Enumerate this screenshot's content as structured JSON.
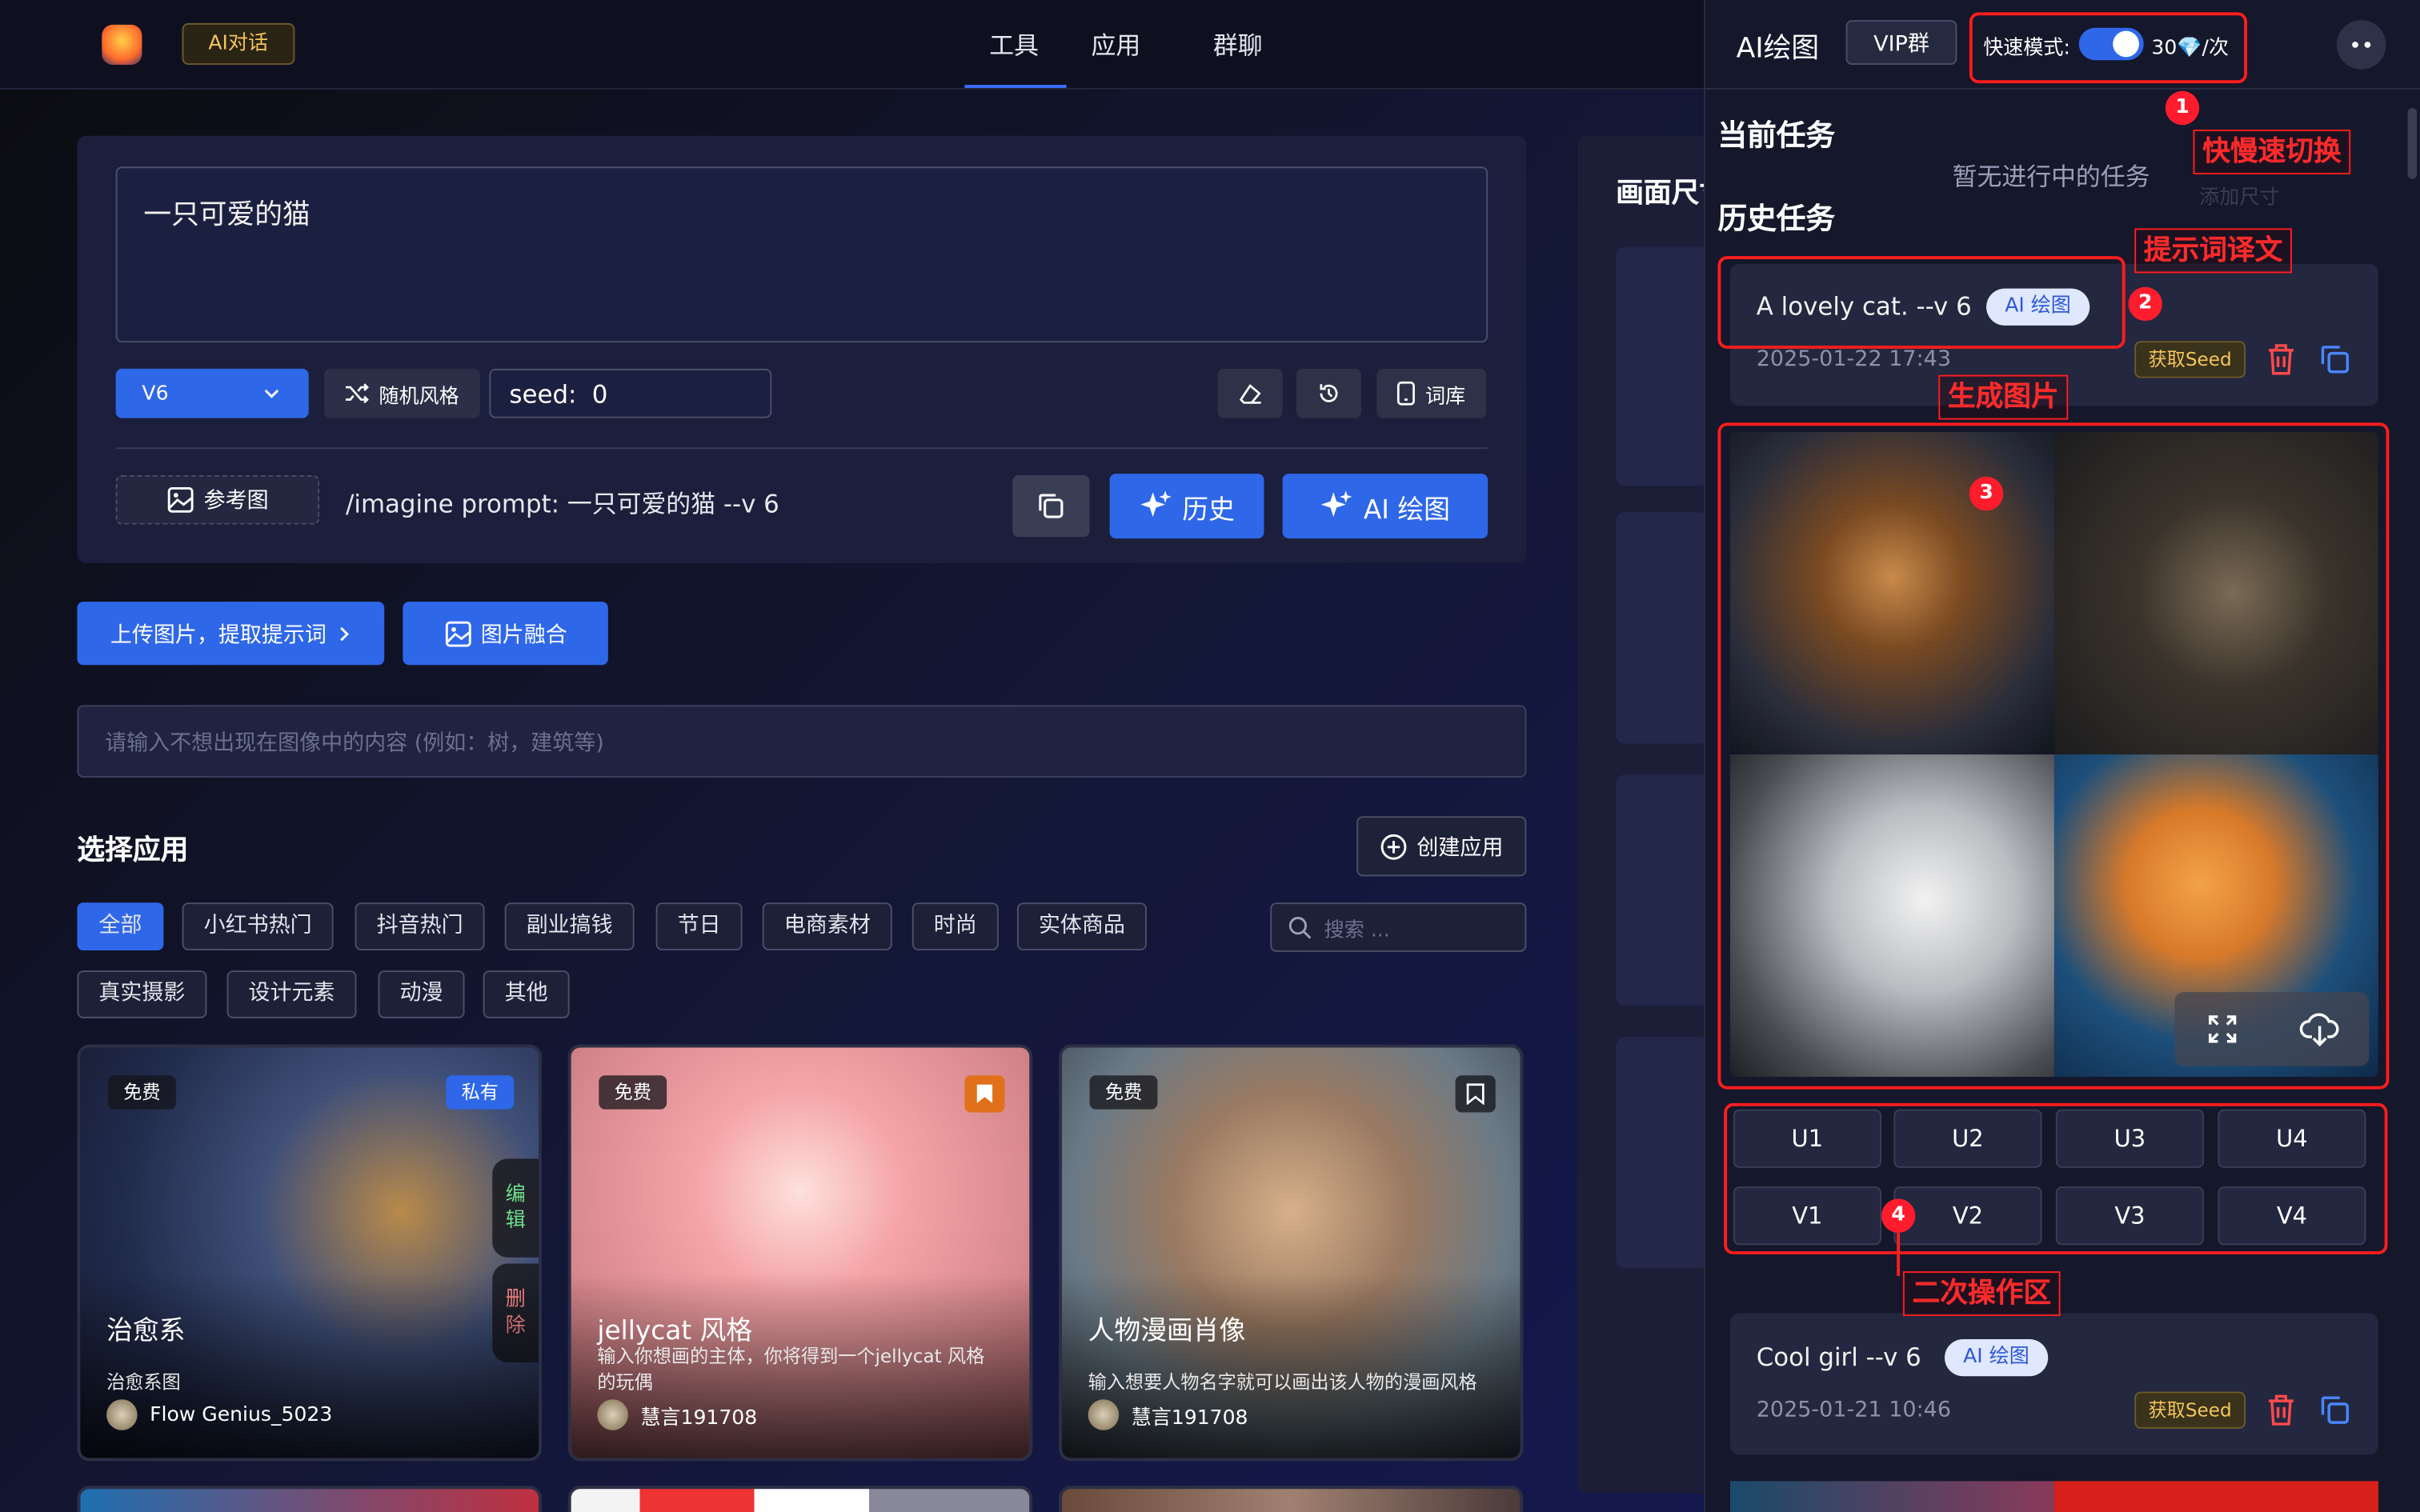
{
  "header": {
    "ai_chat": "AI对话",
    "tabs": [
      "工具",
      "应用",
      "群聊"
    ]
  },
  "prompt": {
    "text": "一只可爱的猫",
    "model": "V6",
    "random_style": "随机风格",
    "seed_label": "seed:",
    "seed_value": "0",
    "lexicon": "词库",
    "ref_image": "参考图",
    "imagine_cmd": "/imagine prompt: 一只可爱的猫 --v 6",
    "history": "历史",
    "ai_draw": "AI 绘图"
  },
  "actions": {
    "upload": "上传图片，提取提示词",
    "fusion": "图片融合",
    "negative_placeholder": "请输入不想出现在图像中的内容 (例如：树，建筑等)"
  },
  "apps": {
    "title": "选择应用",
    "create": "创建应用",
    "search_placeholder": "搜索 ...",
    "categories": [
      "全部",
      "小红书热门",
      "抖音热门",
      "副业搞钱",
      "节日",
      "电商素材",
      "时尚",
      "实体商品",
      "真实摄影",
      "设计元素",
      "动漫",
      "其他"
    ],
    "cards": [
      {
        "badge": "免费",
        "private": "私有",
        "edit": "编辑",
        "delete": "删除",
        "title": "治愈系",
        "desc": "治愈系图",
        "user": "Flow Genius_5023"
      },
      {
        "badge": "免费",
        "title": "jellycat 风格",
        "desc": "输入你想画的主体，你将得到一个jellycat 风格的玩偶",
        "user": "慧言191708"
      },
      {
        "badge": "免费",
        "title": "人物漫画肖像",
        "desc": "输入想要人物名字就可以画出该人物的漫画风格",
        "user": "慧言191708"
      }
    ]
  },
  "middle": {
    "title": "画面尺寸"
  },
  "drawer": {
    "title": "AI绘图",
    "vip_group": "VIP群",
    "fast_mode_label": "快速模式:",
    "cost": "30💎/次",
    "current_task": "当前任务",
    "no_task": "暂无进行中的任务",
    "history_task": "历史任务",
    "tasks": [
      {
        "prompt": "A lovely cat. --v 6",
        "tag": "AI 绘图",
        "time": "2025-01-22 17:43",
        "seed": "获取Seed"
      },
      {
        "prompt": "Cool girl --v 6",
        "tag": "AI 绘图",
        "time": "2025-01-21 10:46",
        "seed": "获取Seed"
      }
    ],
    "upscale": [
      "U1",
      "U2",
      "U3",
      "U4"
    ],
    "variation": [
      "V1",
      "V2",
      "V3",
      "V4"
    ],
    "ghost_text": "添加尺寸"
  },
  "annotations": {
    "labels": [
      "快慢速切换",
      "提示词译文",
      "生成图片",
      "二次操作区"
    ],
    "numbers": [
      "1",
      "2",
      "3",
      "4"
    ]
  },
  "colors": {
    "accent": "#2e67e8",
    "annotation": "#ff1d1d",
    "seed_gold": "#f3c55a"
  }
}
